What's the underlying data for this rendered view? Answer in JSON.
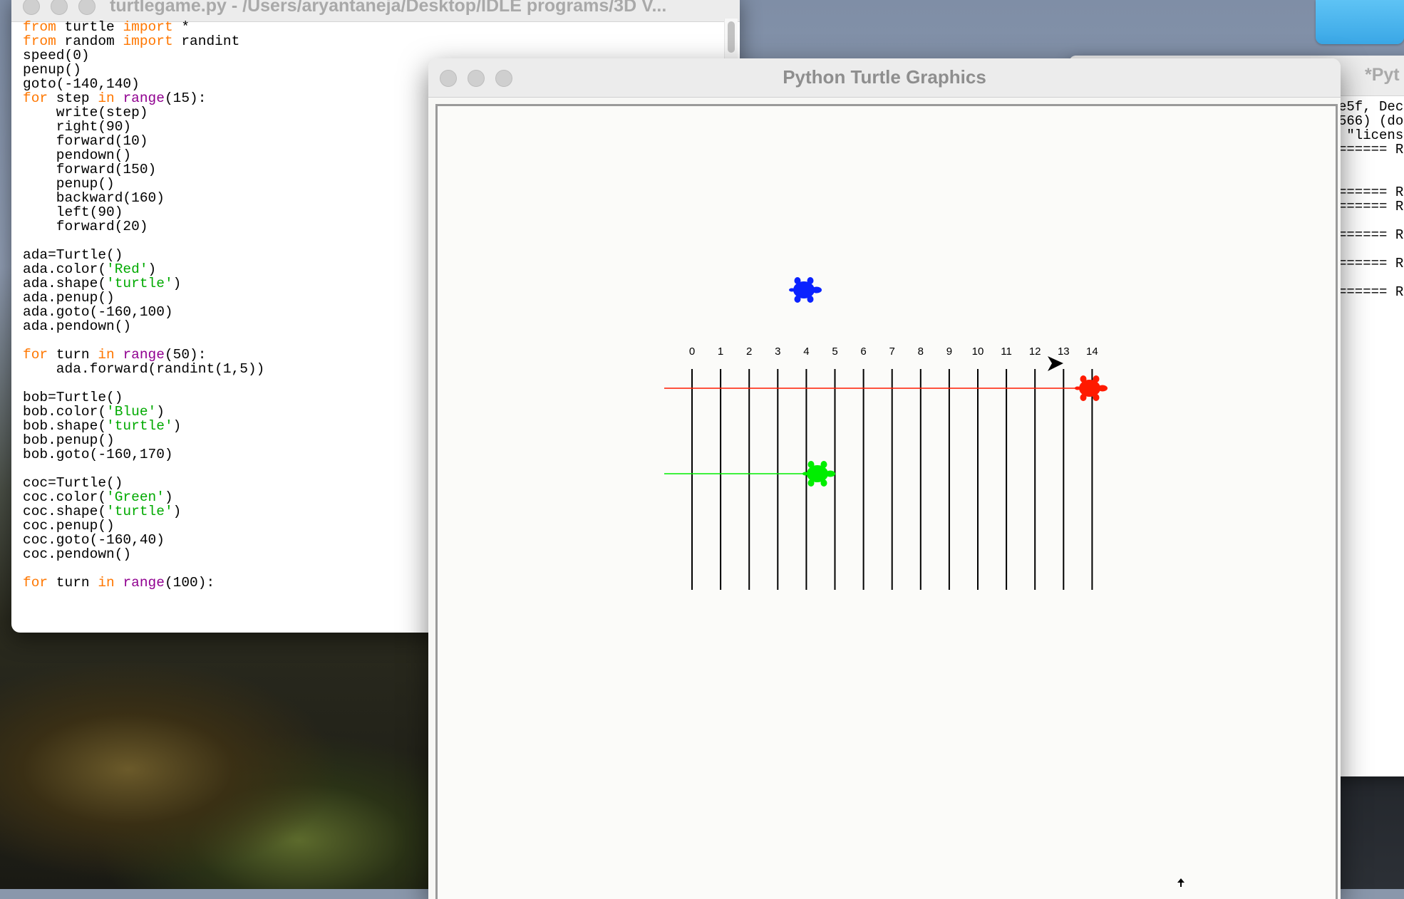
{
  "editor": {
    "title": "turtlegame.py - /Users/aryantaneja/Desktop/IDLE programs/3D V...",
    "code_lines": [
      [
        [
          "kw",
          "from"
        ],
        [
          "",
          " turtle "
        ],
        [
          "kw",
          "import"
        ],
        [
          "",
          " *"
        ]
      ],
      [
        [
          "kw",
          "from"
        ],
        [
          "",
          " random "
        ],
        [
          "kw",
          "import"
        ],
        [
          "",
          " randint"
        ]
      ],
      [
        [
          "",
          "speed(0)"
        ]
      ],
      [
        [
          "",
          "penup()"
        ]
      ],
      [
        [
          "",
          "goto(-140,140)"
        ]
      ],
      [
        [
          "kw",
          "for"
        ],
        [
          "",
          " step "
        ],
        [
          "kw",
          "in"
        ],
        [
          "",
          " "
        ],
        [
          "bi",
          "range"
        ],
        [
          "",
          "(15):"
        ]
      ],
      [
        [
          "",
          "    write(step)"
        ]
      ],
      [
        [
          "",
          "    right(90)"
        ]
      ],
      [
        [
          "",
          "    forward(10)"
        ]
      ],
      [
        [
          "",
          "    pendown()"
        ]
      ],
      [
        [
          "",
          "    forward(150)"
        ]
      ],
      [
        [
          "",
          "    penup()"
        ]
      ],
      [
        [
          "",
          "    backward(160)"
        ]
      ],
      [
        [
          "",
          "    left(90)"
        ]
      ],
      [
        [
          "",
          "    forward(20)"
        ]
      ],
      [
        [
          "",
          ""
        ]
      ],
      [
        [
          "",
          "ada=Turtle()"
        ]
      ],
      [
        [
          "",
          "ada.color("
        ],
        [
          "st",
          "'Red'"
        ],
        [
          "",
          ")"
        ]
      ],
      [
        [
          "",
          "ada.shape("
        ],
        [
          "st",
          "'turtle'"
        ],
        [
          "",
          ")"
        ]
      ],
      [
        [
          "",
          "ada.penup()"
        ]
      ],
      [
        [
          "",
          "ada.goto(-160,100)"
        ]
      ],
      [
        [
          "",
          "ada.pendown()"
        ]
      ],
      [
        [
          "",
          ""
        ]
      ],
      [
        [
          "kw",
          "for"
        ],
        [
          "",
          " turn "
        ],
        [
          "kw",
          "in"
        ],
        [
          "",
          " "
        ],
        [
          "bi",
          "range"
        ],
        [
          "",
          "(50):"
        ]
      ],
      [
        [
          "",
          "    ada.forward(randint(1,5))"
        ]
      ],
      [
        [
          "",
          ""
        ]
      ],
      [
        [
          "",
          "bob=Turtle()"
        ]
      ],
      [
        [
          "",
          "bob.color("
        ],
        [
          "st",
          "'Blue'"
        ],
        [
          "",
          ")"
        ]
      ],
      [
        [
          "",
          "bob.shape("
        ],
        [
          "st",
          "'turtle'"
        ],
        [
          "",
          ")"
        ]
      ],
      [
        [
          "",
          "bob.penup()"
        ]
      ],
      [
        [
          "",
          "bob.goto(-160,170)"
        ]
      ],
      [
        [
          "",
          ""
        ]
      ],
      [
        [
          "",
          "coc=Turtle()"
        ]
      ],
      [
        [
          "",
          "coc.color("
        ],
        [
          "st",
          "'Green'"
        ],
        [
          "",
          ")"
        ]
      ],
      [
        [
          "",
          "coc.shape("
        ],
        [
          "st",
          "'turtle'"
        ],
        [
          "",
          ")"
        ]
      ],
      [
        [
          "",
          "coc.penup()"
        ]
      ],
      [
        [
          "",
          "coc.goto(-160,40)"
        ]
      ],
      [
        [
          "",
          "coc.pendown()"
        ]
      ],
      [
        [
          "",
          ""
        ]
      ],
      [
        [
          "kw",
          "for"
        ],
        [
          "",
          " turn "
        ],
        [
          "kw",
          "in"
        ],
        [
          "",
          " "
        ],
        [
          "bi",
          "range"
        ],
        [
          "",
          "(100):"
        ]
      ]
    ]
  },
  "shell": {
    "title": "*Pyt",
    "lines": [
      "e5f, Dec",
      "566) (do",
      " \"licens",
      "====== R",
      "",
      "",
      "====== R",
      "====== R",
      "",
      "====== R",
      "",
      "====== R",
      "",
      "====== R"
    ]
  },
  "turtle_window": {
    "title": "Python Turtle Graphics",
    "step_labels": [
      "0",
      "1",
      "2",
      "3",
      "4",
      "5",
      "6",
      "7",
      "8",
      "9",
      "10",
      "11",
      "12",
      "13",
      "14"
    ],
    "turtles": [
      {
        "name": "bob",
        "color": "#0a22ff",
        "track": false,
        "line_color": "#0a22ff"
      },
      {
        "name": "ada",
        "color": "#ff1a00",
        "track": true,
        "line_color": "#ff1a00"
      },
      {
        "name": "coc",
        "color": "#00ee00",
        "track": true,
        "line_color": "#00ee00"
      }
    ],
    "colors": {
      "lane_line": "#000000",
      "background": "#fbfbf9"
    }
  }
}
